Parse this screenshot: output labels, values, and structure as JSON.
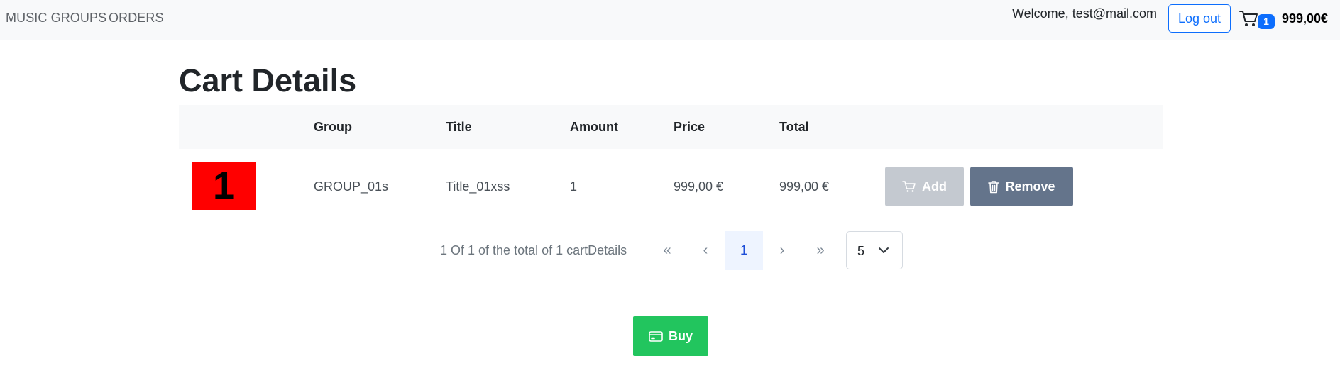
{
  "nav": {
    "links": [
      "MUSIC GROUPS",
      "ORDERS"
    ],
    "welcome": "Welcome, test@mail.com",
    "logout_label": "Log out",
    "cart_count": "1",
    "cart_total": "999,00€"
  },
  "page": {
    "title": "Cart Details"
  },
  "table": {
    "columns": [
      "",
      "Group",
      "Title",
      "Amount",
      "Price",
      "Total"
    ],
    "rows": [
      {
        "thumbnail_text": "1",
        "group": "GROUP_01s",
        "title": "Title_01xss",
        "amount": "1",
        "price": "999,00 €",
        "total": "999,00 €",
        "add_label": "Add",
        "remove_label": "Remove"
      }
    ]
  },
  "pagination": {
    "info": "1 Of 1 of the total of 1 cartDetails",
    "first": "«",
    "prev": "‹",
    "current_page": "1",
    "next": "›",
    "last": "»",
    "page_size": "5"
  },
  "buy_label": "Buy",
  "colors": {
    "primary": "#0d6efd",
    "add_disabled": "#c4c9d0",
    "remove": "#64748b",
    "buy": "#22c55e",
    "thumbnail": "#ff0000"
  },
  "icons": [
    "cart-icon",
    "cart-small-icon",
    "trash-icon",
    "credit-card-icon",
    "chevron-down-icon"
  ]
}
